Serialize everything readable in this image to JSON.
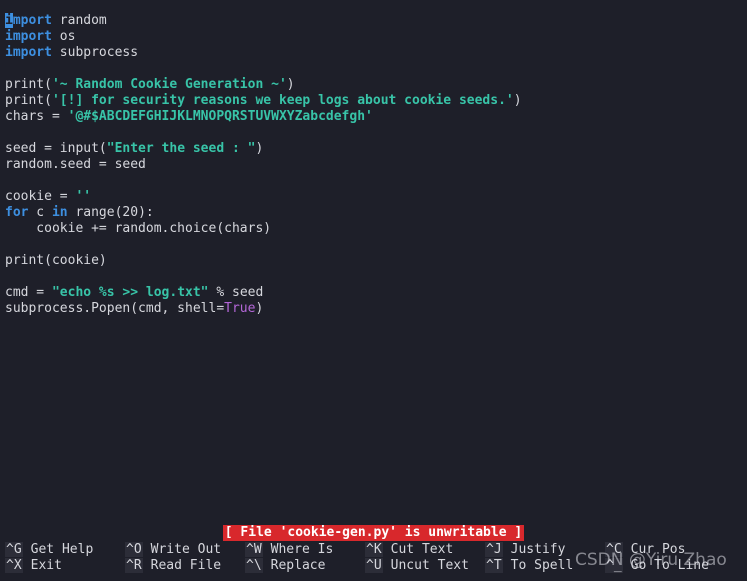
{
  "code": {
    "l1_a": "i",
    "l1_b": "mport",
    "l1_c": " random",
    "l2_kw": "import",
    "l2_rest": " os",
    "l3_kw": "import",
    "l3_rest": " subprocess",
    "l5_a": "print(",
    "l5_str": "'~ Random Cookie Generation ~'",
    "l5_b": ")",
    "l6_a": "print(",
    "l6_str": "'[!] for security reasons we keep logs about cookie seeds.'",
    "l6_b": ")",
    "l7_a": "chars = ",
    "l7_str": "'@#$ABCDEFGHIJKLMNOPQRSTUVWXYZabcdefgh'",
    "l9_a": "seed = input(",
    "l9_str": "\"Enter the seed : \"",
    "l9_b": ")",
    "l10": "random.seed = seed",
    "l12_a": "cookie = ",
    "l12_str": "''",
    "l13_kw1": "for",
    "l13_a": " c ",
    "l13_kw2": "in",
    "l13_b": " range(20):",
    "l14": "    cookie += random.choice(chars)",
    "l16": "print(cookie)",
    "l18_a": "cmd = ",
    "l18_str": "\"echo %s >> log.txt\"",
    "l18_b": " % seed",
    "l19_a": "subprocess.Popen(cmd, shell=",
    "l19_bool": "True",
    "l19_b": ")"
  },
  "status_message": "[ File 'cookie-gen.py' is unwritable ]",
  "shortcuts": [
    {
      "key": "^G",
      "label": "Get Help"
    },
    {
      "key": "^X",
      "label": "Exit"
    },
    {
      "key": "^O",
      "label": "Write Out"
    },
    {
      "key": "^R",
      "label": "Read File"
    },
    {
      "key": "^W",
      "label": "Where Is"
    },
    {
      "key": "^\\",
      "label": "Replace"
    },
    {
      "key": "^K",
      "label": "Cut Text"
    },
    {
      "key": "^U",
      "label": "Uncut Text"
    },
    {
      "key": "^J",
      "label": "Justify"
    },
    {
      "key": "^T",
      "label": "To Spell"
    },
    {
      "key": "^C",
      "label": "Cur Pos"
    },
    {
      "key": "^_",
      "label": "Go To Line"
    }
  ],
  "watermark": "CSDN @Yiru Zhao",
  "colors": {
    "background": "#1e1f29",
    "keyword": "#3d8fe0",
    "string": "#38c4a8",
    "boolean": "#b467d8",
    "status_bg": "#d8282c"
  }
}
